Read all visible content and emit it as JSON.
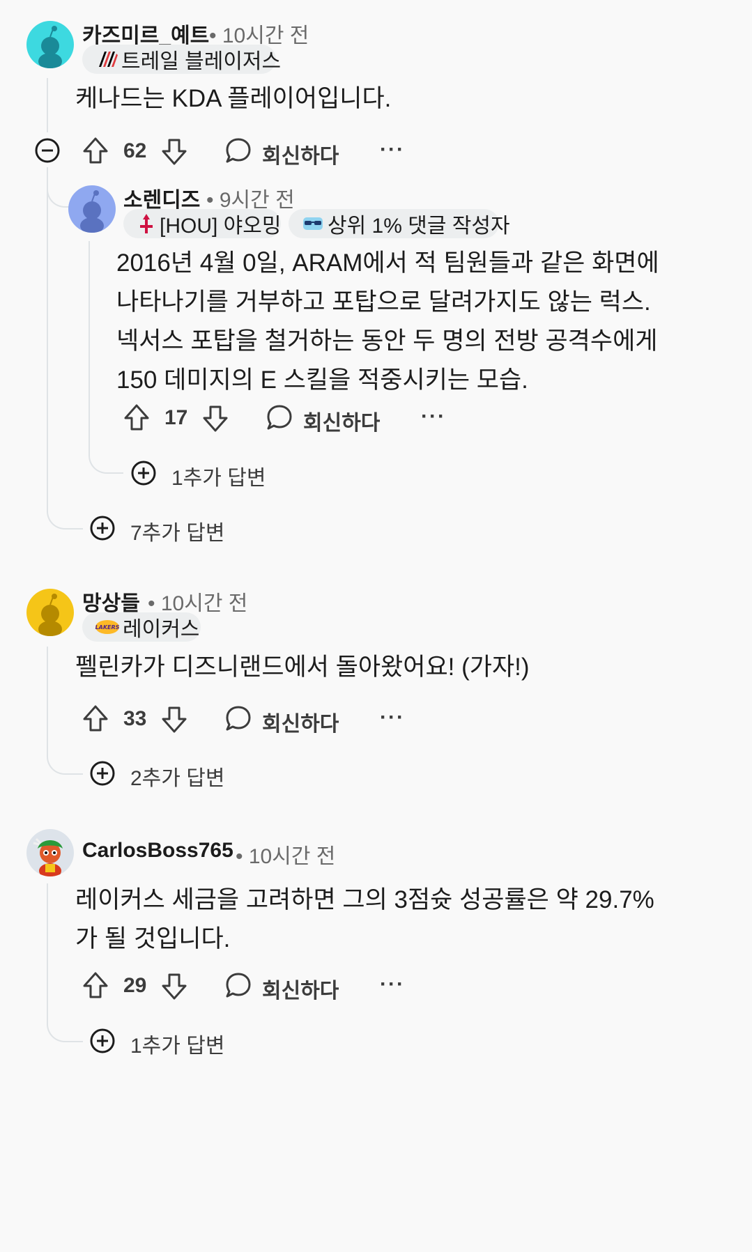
{
  "comments": [
    {
      "username": "카즈미르_예트",
      "time": "10시간 전",
      "flair": "트레일 블레이저스",
      "body": [
        "케나드는 KDA 플레이어입니다."
      ],
      "score": "62",
      "reply_label": "회신하다",
      "more_replies": "7추가 답변",
      "avatar_color": "#3dd9e0",
      "replies": [
        {
          "username": "소렌디즈",
          "time": "9시간 전",
          "flair": "[HOU] 야오밍",
          "badge": "상위 1% 댓글 작성자",
          "body": [
            "2016년 4월 0일, ARAM에서 적 팀원들과 같은 화면에",
            "나타나기를 거부하고 포탑으로 달려가지도 않는 럭스.",
            "넥서스 포탑을 철거하는 동안 두 명의 전방 공격수에게",
            "150 데미지의 E 스킬을 적중시키는 모습."
          ],
          "score": "17",
          "reply_label": "회신하다",
          "more_replies": "1추가 답변",
          "avatar_color": "#8fa8f0"
        }
      ]
    },
    {
      "username": "망상들",
      "time": "10시간 전",
      "flair": "레이커스",
      "flair_logo_text": "LAKERS",
      "body": [
        "펠린카가 디즈니랜드에서 돌아왔어요! (가자!)"
      ],
      "score": "33",
      "reply_label": "회신하다",
      "more_replies": "2추가 답변",
      "avatar_color": "#f5c518"
    },
    {
      "username": "CarlosBoss765",
      "time": "10시간 전",
      "body": [
        "레이커스 세금을 고려하면 그의 3점슛 성공률은 약 29.7%",
        "가 될 것입니다."
      ],
      "score": "29",
      "reply_label": "회신하다",
      "more_replies": "1추가 답변"
    }
  ],
  "separator_dot": "•",
  "more_glyph": "···"
}
